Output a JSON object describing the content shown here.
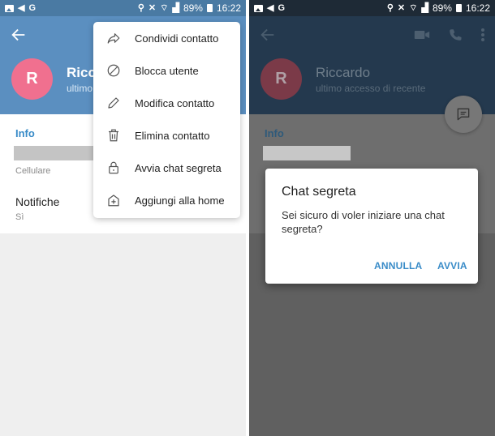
{
  "status_bar": {
    "left_icons": [
      "image-icon",
      "telegram-icon",
      "google-icon"
    ],
    "google_letter": "G",
    "right_icons": [
      "location-icon",
      "mute-vibrate-icon",
      "wifi-icon",
      "signal-icon"
    ],
    "battery": "89%",
    "time": "16:22"
  },
  "profile": {
    "avatar_letter": "R",
    "name": "Riccardo",
    "name_truncated": "Ricc",
    "last_seen": "ultimo accesso di recente",
    "last_seen_truncated": "ultimo",
    "info_label": "Info",
    "phone_label": "Cellulare",
    "notifications_label": "Notifiche",
    "notifications_value": "Sì"
  },
  "menu": {
    "items": [
      {
        "label": "Condividi contatto",
        "icon": "share-icon"
      },
      {
        "label": "Blocca utente",
        "icon": "block-icon"
      },
      {
        "label": "Modifica contatto",
        "icon": "edit-icon"
      },
      {
        "label": "Elimina contatto",
        "icon": "trash-icon"
      },
      {
        "label": "Avvia chat segreta",
        "icon": "lock-icon"
      },
      {
        "label": "Aggiungi alla home",
        "icon": "add-home-icon"
      }
    ]
  },
  "dialog": {
    "title": "Chat segreta",
    "message": "Sei sicuro di voler iniziare una chat segreta?",
    "cancel_label": "ANNULLA",
    "confirm_label": "AVVIA"
  },
  "colors": {
    "header_blue": "#5b8fc0",
    "accent_blue": "#3a8cc8",
    "avatar_pink": "#f0708f"
  }
}
